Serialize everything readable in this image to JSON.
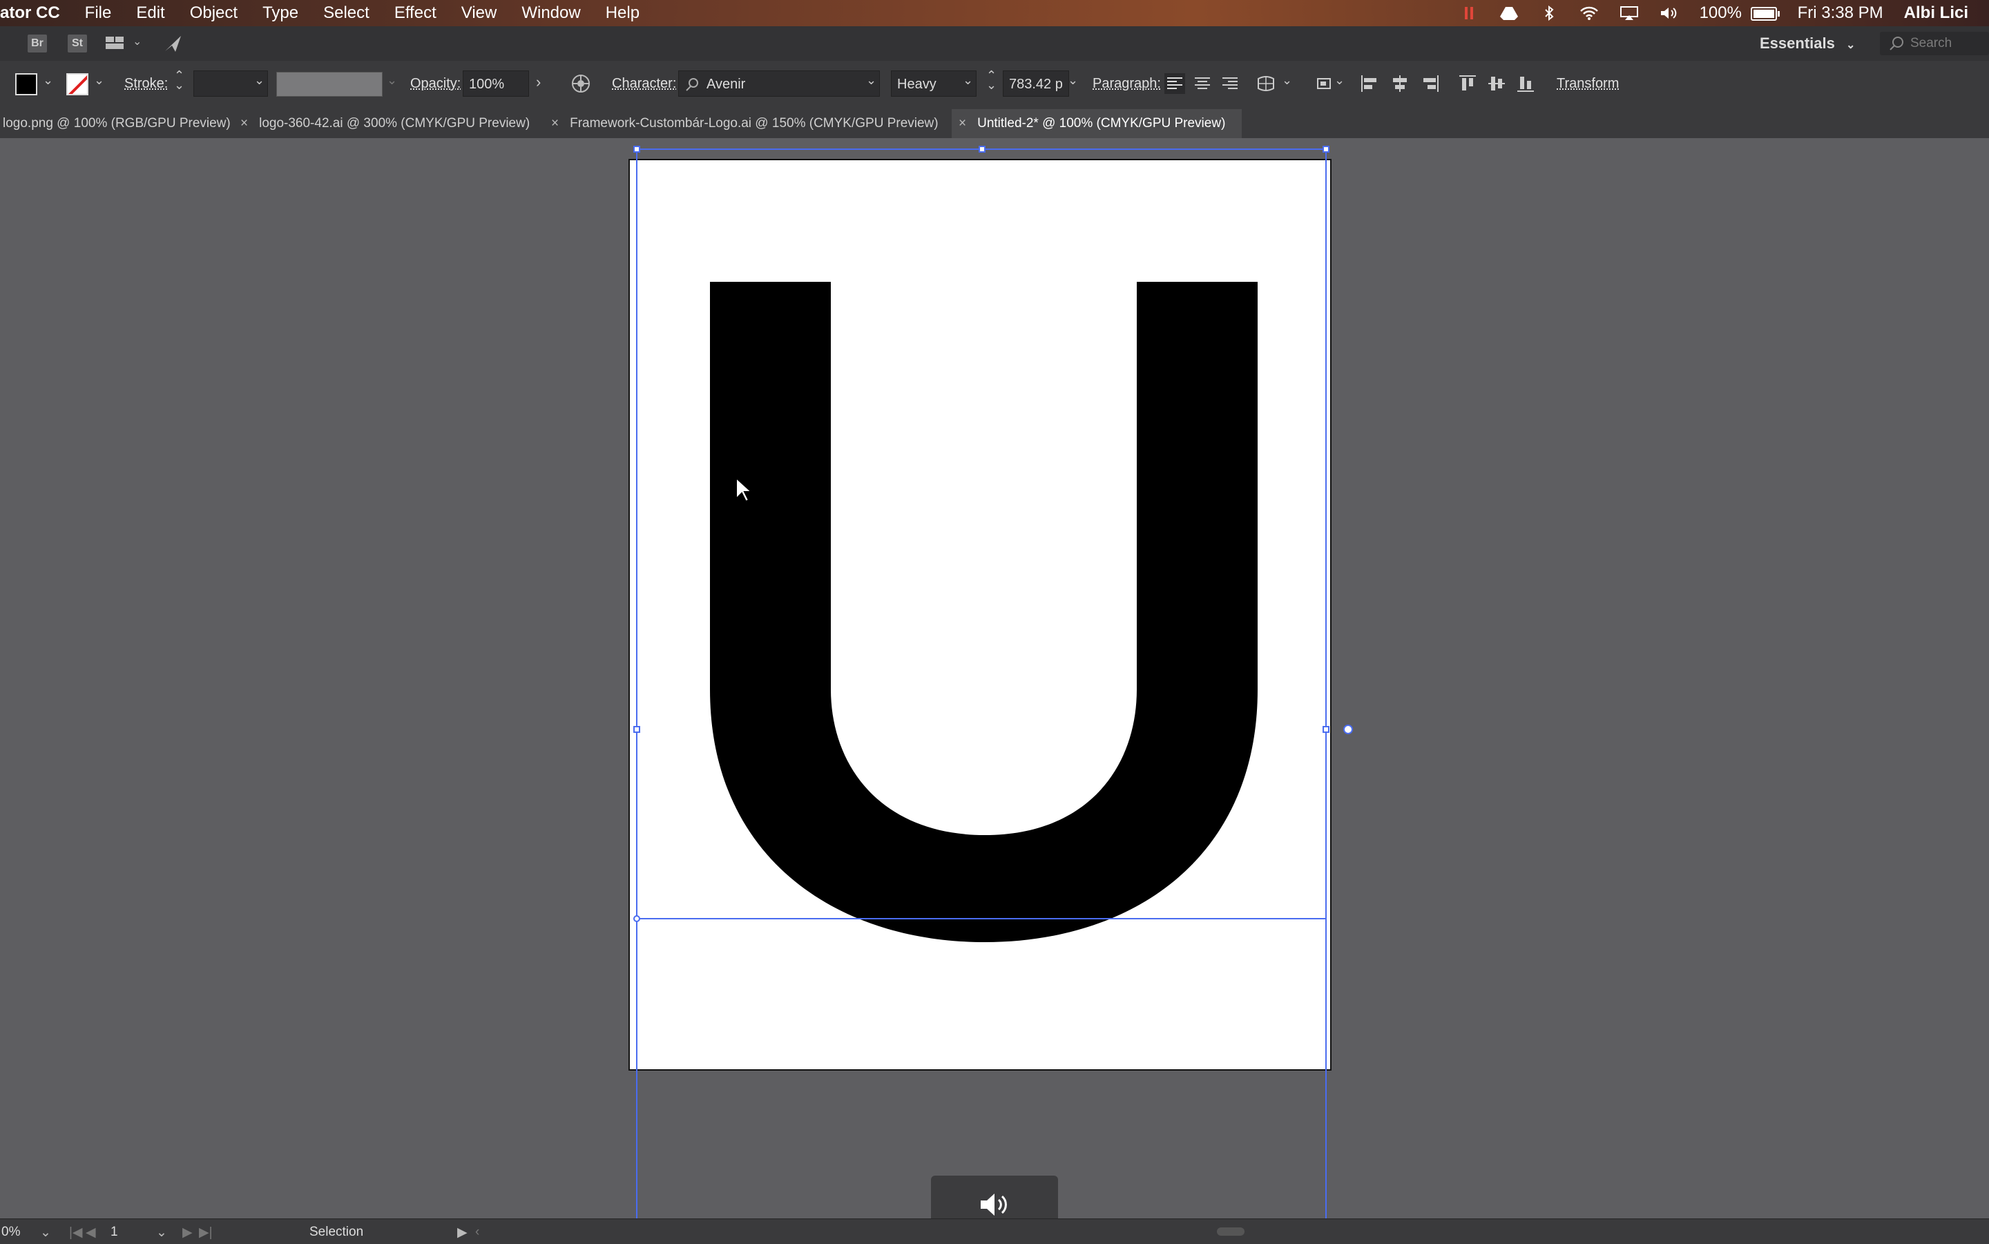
{
  "menubar": {
    "app_name": "ator CC",
    "items": [
      "File",
      "Edit",
      "Object",
      "Type",
      "Select",
      "Effect",
      "View",
      "Window",
      "Help"
    ],
    "battery": "100%",
    "battery_level": 1.0,
    "clock": "Fri 3:38 PM",
    "user": "Albi Lici",
    "status_icons": [
      "recording-icon",
      "drive-icon",
      "bluetooth-icon",
      "wifi-icon",
      "airplay-icon",
      "volume-icon"
    ]
  },
  "appbar": {
    "badges": [
      "Br",
      "St"
    ],
    "workspace": "Essentials",
    "search_placeholder": "Search Adobe"
  },
  "control": {
    "stroke_label": "Stroke:",
    "opacity_label": "Opacity:",
    "opacity_value": "100%",
    "character_label": "Character:",
    "font_family": "Avenir",
    "font_style": "Heavy",
    "font_size": "783.42 p",
    "paragraph_label": "Paragraph:",
    "transform_label": "Transform",
    "fill_color": "#000000"
  },
  "tabs": [
    {
      "label": "logo.png @ 100% (RGB/GPU Preview)",
      "active": false
    },
    {
      "label": "logo-360-42.ai @ 300% (CMYK/GPU Preview)",
      "active": false
    },
    {
      "label": "Framework-Custombár-Logo.ai @ 150% (CMYK/GPU Preview)",
      "active": false
    },
    {
      "label": "Untitled-2* @ 100% (CMYK/GPU Preview)",
      "active": true
    }
  ],
  "artboard": {
    "glyph": "U",
    "glyph_color": "#000000",
    "selection_color": "#4a6cf0"
  },
  "statusbar": {
    "zoom": "0%",
    "page": "1",
    "tool": "Selection"
  }
}
